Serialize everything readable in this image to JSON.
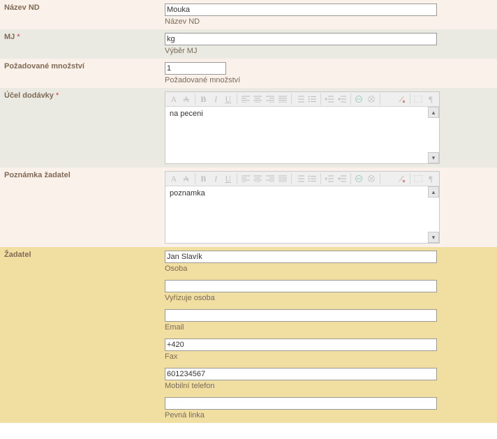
{
  "nazev_nd": {
    "label": "Název ND",
    "value": "Mouka",
    "help": "Název ND"
  },
  "mj": {
    "label": "MJ",
    "required": "*",
    "value": "kg",
    "help": "Výběr MJ"
  },
  "mnozstvi": {
    "label": "Požadované množství",
    "value": "1",
    "help": "Požadované množství"
  },
  "ucel": {
    "label": "Účel dodávky",
    "required": "*",
    "text": "na peceni"
  },
  "poznamka": {
    "label": "Poznámka žadatel",
    "text": "poznamka"
  },
  "zadatel": {
    "label": "Žadatel",
    "osoba": {
      "value": "Jan Slavík",
      "help": "Osoba"
    },
    "vyrizuje": {
      "value": "",
      "help": "Vyřizuje osoba"
    },
    "email": {
      "value": "",
      "help": "Email"
    },
    "fax": {
      "value": "+420",
      "help": "Fax"
    },
    "mobil": {
      "value": "601234567",
      "help": "Mobilní telefon"
    },
    "pevna": {
      "value": "",
      "help": "Pevná linka"
    }
  },
  "toolbar": {
    "A": "A",
    "ALine": "A",
    "B": "B",
    "I": "I",
    "U": "U",
    "S": "S",
    "Acol�": "A",
    "pilcrow": "¶"
  }
}
